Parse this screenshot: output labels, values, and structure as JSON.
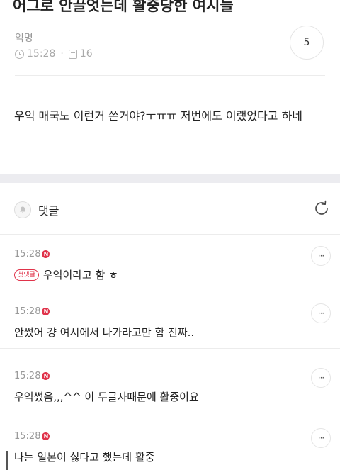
{
  "post": {
    "title": "어그로 안끌엇는데 활중당한 여시들",
    "author": "익명",
    "time": "15:28",
    "views": "16",
    "comment_count": "5",
    "body": "우익 매국노 이런거 쓴거야?ㅜㅠㅠ 저번에도 이랬었다고 하네"
  },
  "comments_section": {
    "label": "댓글"
  },
  "comments": [
    {
      "time": "15:28",
      "new_badge": "N",
      "first_badge": "첫댓글",
      "text": "우익이라고 함 ㅎ",
      "more": "···"
    },
    {
      "time": "15:28",
      "new_badge": "N",
      "text": "안썼어 걍 여시에서 나가라고만 함 진짜..",
      "more": "···"
    },
    {
      "time": "15:28",
      "new_badge": "N",
      "text": "우익썼음,,,^^ 이 두글자때문에 활중이요",
      "more": "···"
    },
    {
      "time": "15:28",
      "new_badge": "N",
      "text": "나는 일본이 싫다고 했는데 활중",
      "more": "···"
    }
  ],
  "colors": {
    "accent": "#e0334a",
    "divider": "#ececec",
    "section_gap": "#ececf0"
  },
  "icons": [
    "clock-icon",
    "document-icon",
    "bell-icon",
    "refresh-icon",
    "more-icon"
  ]
}
